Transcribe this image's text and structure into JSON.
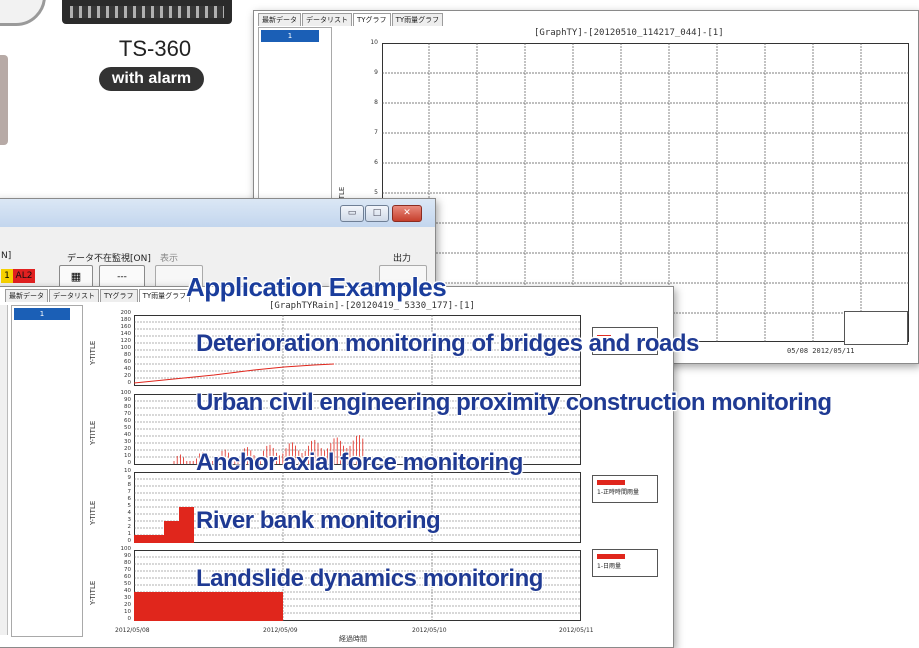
{
  "device": {
    "model": "TS-360",
    "badge": "with alarm"
  },
  "top_window": {
    "tabs": [
      "最新データ",
      "データリスト",
      "TYグラフ",
      "TY雨量グラフ"
    ],
    "active_tab": 2,
    "channel": "1",
    "graph_title": "[GraphTY]-[20120510_114217_044]-[1]",
    "y_ticks": [
      "10",
      "9",
      "8",
      "7",
      "6",
      "5"
    ],
    "y_title": "Y-TITLE",
    "date_fragment": "05/08 2012/05/11"
  },
  "middle_window": {
    "label_nodata": "データ不在監視[ON]",
    "label_display": "表示",
    "label_output": "出力",
    "label_left": "N]",
    "alarm_left": "1",
    "alarm_al2": "AL2",
    "btn_dash": "---"
  },
  "bottom_window": {
    "tabs": [
      "最新データ",
      "データリスト",
      "TYグラフ",
      "TY雨量グラフ"
    ],
    "active_tab": 3,
    "channel": "1",
    "graph_title": "[GraphTYRain]-[20120419_  5330_177]-[1]",
    "panel1_ticks": [
      "200",
      "180",
      "160",
      "140",
      "120",
      "100",
      "80",
      "60",
      "40",
      "20",
      "0"
    ],
    "panel2_ticks": [
      "100",
      "90",
      "80",
      "70",
      "60",
      "50",
      "40",
      "30",
      "20",
      "10",
      "0"
    ],
    "panel3_ticks": [
      "10",
      "9",
      "8",
      "7",
      "6",
      "5",
      "4",
      "3",
      "2",
      "1",
      "0"
    ],
    "panel4_ticks": [
      "100",
      "90",
      "80",
      "70",
      "60",
      "50",
      "40",
      "30",
      "20",
      "10",
      "0"
    ],
    "y_title": "Y-TITLE",
    "legend_1h": "1-正時時間雨量",
    "legend_1d": "1-日雨量",
    "x_ticks": [
      "2012/05/08",
      "2012/05/09",
      "2012/05/10",
      "2012/05/11"
    ],
    "x_label": "経過時間"
  },
  "overlay": {
    "heading": "Application Examples",
    "items": [
      "Deterioration monitoring of bridges and roads",
      "Urban civil engineering proximity construction monitoring",
      "Anchor axial force monitoring",
      "River bank monitoring",
      "Landslide dynamics monitoring"
    ]
  },
  "colors": {
    "accent_blue": "#1f3a93",
    "rain_red": "#e0261c",
    "channel_blue": "#1b5fb6",
    "alarm_red": "#e02020",
    "alarm_yellow": "#f5d000"
  }
}
